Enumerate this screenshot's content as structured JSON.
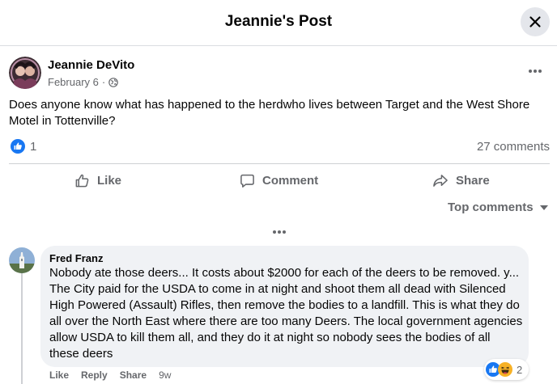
{
  "header": {
    "title": "Jeannie's Post",
    "close_icon": "close-icon"
  },
  "post": {
    "author": "Jeannie DeVito",
    "date": "February 6",
    "separator": "·",
    "audience_icon": "globe-icon",
    "more_icon": "more-horizontal-icon",
    "text": "Does anyone know what has happened to the herdwho lives between Target and the West Shore Motel in Tottenville?",
    "reaction_count": "1",
    "comments_label": "27 comments"
  },
  "actions": {
    "like": "Like",
    "comment": "Comment",
    "share": "Share"
  },
  "comments_section": {
    "sort_label": "Top comments",
    "more_icon": "more-horizontal-icon",
    "comment": {
      "author": "Fred Franz",
      "text": "Nobody ate those deers... It costs about $2000 for each of the deers to be removed. y... The City paid for the USDA to come in at night and shoot them all dead with Silenced High Powered (Assault) Rifles, then remove the bodies to a landfill. This is what they do all over the North East where there are too many Deers. The local government agencies allow USDA to kill them all, and they do it at night so nobody sees the bodies of all these deers",
      "reaction_count": "2",
      "reactions": [
        "like",
        "haha"
      ],
      "actions": {
        "like": "Like",
        "reply": "Reply",
        "share": "Share"
      },
      "time": "9w"
    }
  },
  "colors": {
    "accent": "#1877f2",
    "secondary_text": "#65676b",
    "bubble": "#f0f2f5",
    "haha": "#f7b125"
  }
}
